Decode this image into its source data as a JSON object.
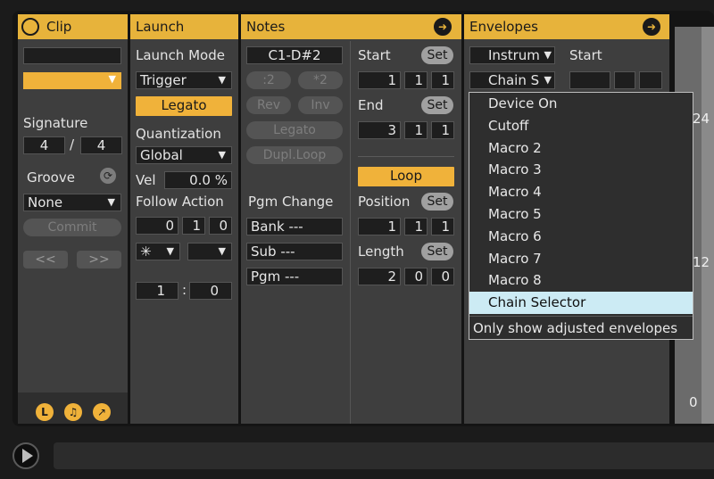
{
  "clip": {
    "title": "Clip",
    "signature_label": "Signature",
    "signature_num": "4",
    "signature_sep": "/",
    "signature_den": "4",
    "groove_label": "Groove",
    "groove_value": "None",
    "commit_label": "Commit",
    "nudge_back": "<<",
    "nudge_fwd": ">>",
    "footer_icons": [
      "L",
      "♫",
      "↗"
    ]
  },
  "launch": {
    "title": "Launch",
    "mode_label": "Launch Mode",
    "mode_value": "Trigger",
    "legato": "Legato",
    "quant_label": "Quantization",
    "quant_value": "Global",
    "vel_label": "Vel",
    "vel_value": "0.0 %",
    "follow_label": "Follow Action",
    "follow_time": [
      "0",
      "1",
      "0"
    ],
    "action_a": "✳",
    "chance": [
      "1",
      ":",
      "0"
    ]
  },
  "notes": {
    "title": "Notes",
    "range": "C1-D#2",
    "div2": ":2",
    "mul2": "*2",
    "rev": "Rev",
    "inv": "Inv",
    "legato": "Legato",
    "dupl": "Dupl.Loop",
    "start_label": "Start",
    "start": [
      "1",
      "1",
      "1"
    ],
    "end_label": "End",
    "end": [
      "3",
      "1",
      "1"
    ],
    "set": "Set",
    "loop": "Loop",
    "position_label": "Position",
    "position": [
      "1",
      "1",
      "1"
    ],
    "length_label": "Length",
    "length": [
      "2",
      "0",
      "0"
    ],
    "pgm_change": "Pgm Change",
    "bank": "Bank ---",
    "sub": "Sub ---",
    "pgm": "Pgm ---"
  },
  "envelopes": {
    "title": "Envelopes",
    "device": "Instrum",
    "control": "Chain S",
    "start_label": "Start",
    "menu": [
      "Device On",
      "Cutoff",
      "Macro 2",
      "Macro 3",
      "Macro 4",
      "Macro 5",
      "Macro 6",
      "Macro 7",
      "Macro 8",
      "Chain Selector"
    ],
    "menu_selected": "Chain Selector",
    "only_adjusted": "Only show adjusted envelopes"
  },
  "ruler": [
    "24",
    "12",
    "0"
  ],
  "colors": {
    "accent": "#e7b33b",
    "menu_highlight": "#ccebf4"
  }
}
